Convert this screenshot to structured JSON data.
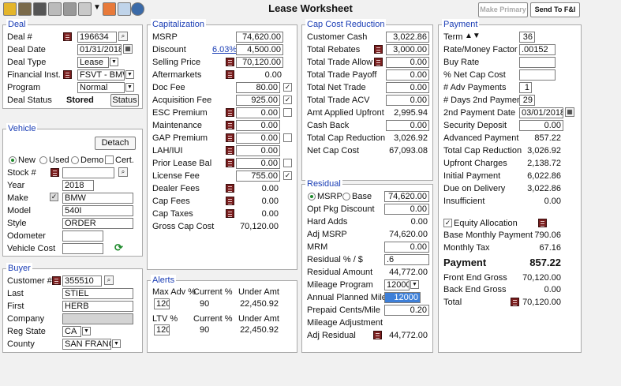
{
  "window": {
    "title": "Lease Worksheet",
    "make_primary": "Make Primary",
    "send_to_fi": "Send To F&I"
  },
  "toolbar": {
    "icons": [
      "dealer-icon",
      "folder-icon",
      "car-icon",
      "form-icon",
      "calculator-icon",
      "tools-icon",
      "dropdown-icon",
      "home-icon",
      "search-icon",
      "calculator2-icon"
    ]
  },
  "deal": {
    "legend": "Deal",
    "deal_no_label": "Deal #",
    "deal_no": "196634",
    "deal_date_label": "Deal Date",
    "deal_date": "01/31/2018",
    "deal_type_label": "Deal Type",
    "deal_type": "Lease",
    "fin_inst_label": "Financial Inst.",
    "fin_inst": "FSVT - BMW",
    "program_label": "Program",
    "program": "Normal",
    "status_label": "Deal Status",
    "status_value": "Stored",
    "status_button": "Status"
  },
  "vehicle": {
    "legend": "Vehicle",
    "detach": "Detach",
    "new": "New",
    "used": "Used",
    "demo": "Demo",
    "cert": "Cert.",
    "stock_label": "Stock #",
    "stock": "",
    "year_label": "Year",
    "year": "2018",
    "make_label": "Make",
    "make": "BMW",
    "model_label": "Model",
    "model": "540I",
    "style_label": "Style",
    "style": "ORDER",
    "odometer_label": "Odometer",
    "odometer": "",
    "cost_label": "Vehicle Cost",
    "cost": ""
  },
  "buyer": {
    "legend": "Buyer",
    "customer_label": "Customer #",
    "customer": "355510",
    "last_label": "Last",
    "last": "STIEL",
    "first_label": "First",
    "first": "HERB",
    "company_label": "Company",
    "company": "",
    "state_label": "Reg State",
    "state": "CA",
    "county_label": "County",
    "county": "SAN FRANCI"
  },
  "cap": {
    "legend": "Capitalization",
    "msrp_label": "MSRP",
    "msrp": "74,620.00",
    "discount_label": "Discount",
    "discount_pct": "6.03%",
    "discount": "4,500.00",
    "selling_label": "Selling Price",
    "selling": "70,120.00",
    "after_label": "Aftermarkets",
    "after": "0.00",
    "docfee_label": "Doc Fee",
    "docfee": "80.00",
    "acq_label": "Acquisition Fee",
    "acq": "925.00",
    "esc_label": "ESC Premium",
    "esc": "0.00",
    "maint_label": "Maintenance",
    "maint": "0.00",
    "gap_label": "GAP Premium",
    "gap": "0.00",
    "lah_label": "LAH/IUI",
    "lah": "0.00",
    "prior_label": "Prior Lease Bal",
    "prior": "0.00",
    "license_label": "License Fee",
    "license": "755.00",
    "dealer_label": "Dealer Fees",
    "dealer": "0.00",
    "capfees_label": "Cap Fees",
    "capfees": "0.00",
    "captaxes_label": "Cap Taxes",
    "captaxes": "0.00",
    "gross_label": "Gross Cap Cost",
    "gross": "70,120.00"
  },
  "alerts": {
    "legend": "Alerts",
    "max_adv_label": "Max Adv %",
    "current_label": "Current %",
    "under_label": "Under Amt",
    "adv_max": "120",
    "adv_cur": "90",
    "adv_under": "22,450.92",
    "ltv_label": "LTV %",
    "ltv_current_label": "Current %",
    "ltv_under_label": "Under Amt",
    "ltv_max": "120",
    "ltv_cur": "90",
    "ltv_under": "22,450.92"
  },
  "ccr": {
    "legend": "Cap Cost Reduction",
    "cash_label": "Customer Cash",
    "cash": "3,022.86",
    "rebates_label": "Total Rebates",
    "rebates": "3,000.00",
    "trade_allow_label": "Total Trade Allow",
    "trade_allow": "0.00",
    "trade_payoff_label": "Total Trade Payoff",
    "trade_payoff": "0.00",
    "net_trade_label": "Total Net Trade",
    "net_trade": "0.00",
    "trade_acv_label": "Total Trade ACV",
    "trade_acv": "0.00",
    "amt_upfront_label": "Amt Applied Upfront",
    "amt_upfront": "2,995.94",
    "cashback_label": "Cash Back",
    "cashback": "0.00",
    "total_ccr_label": "Total Cap Reduction",
    "total_ccr": "3,026.92",
    "net_cap_label": "Net Cap Cost",
    "net_cap": "67,093.08"
  },
  "residual": {
    "legend": "Residual",
    "msrp_radio": "MSRP",
    "base_radio": "Base",
    "base_value": "74,620.00",
    "opt_label": "Opt Pkg Discount",
    "opt": "0.00",
    "hard_label": "Hard Adds",
    "hard": "0.00",
    "adj_msrp_label": "Adj MSRP",
    "adj_msrp": "74,620.00",
    "mrm_label": "MRM",
    "mrm": "0.00",
    "res_pct_label": "Residual % / $",
    "res_pct": ".6",
    "res_amt_label": "Residual Amount",
    "res_amt": "44,772.00",
    "mileage_prog_label": "Mileage Program",
    "mileage_prog": "12000",
    "annual_label": "Annual Planned Miles",
    "annual": "12000",
    "prepaid_label": "Prepaid Cents/Mile",
    "prepaid": "0.20",
    "mileage_adj_label": "Mileage Adjustment",
    "adj_res_label": "Adj Residual",
    "adj_res": "44,772.00"
  },
  "payment": {
    "legend": "Payment",
    "term_label": "Term",
    "term": "36",
    "mf_label": "Rate/Money Factor",
    "mf": ".00152",
    "buy_label": "Buy Rate",
    "buy": "",
    "netcap_label": "% Net Cap Cost",
    "netcap": "",
    "adv_label": "# Adv Payments",
    "adv": "1",
    "days_label": "# Days 2nd Payment",
    "days": "29",
    "date2_label": "2nd Payment Date",
    "date2": "03/01/2018",
    "deposit_label": "Security Deposit",
    "deposit": "0.00",
    "adv_pay_label": "Advanced Payment",
    "adv_pay": "857.22",
    "tcr_label": "Total Cap Reduction",
    "tcr": "3,026.92",
    "upfront_label": "Upfront Charges",
    "upfront": "2,138.72",
    "initial_label": "Initial Payment",
    "initial": "6,022.86",
    "due_label": "Due on Delivery",
    "due": "3,022.86",
    "insuff_label": "Insufficient",
    "insuff": "0.00",
    "equity_label": "Equity Allocation",
    "base_monthly_label": "Base Monthly Payment",
    "base_monthly": "790.06",
    "monthly_tax_label": "Monthly Tax",
    "monthly_tax": "67.16",
    "payment_label": "Payment",
    "payment": "857.22",
    "front_label": "Front End Gross",
    "front": "70,120.00",
    "back_label": "Back End Gross",
    "back": "0.00",
    "total_label": "Total",
    "total": "70,120.00"
  }
}
